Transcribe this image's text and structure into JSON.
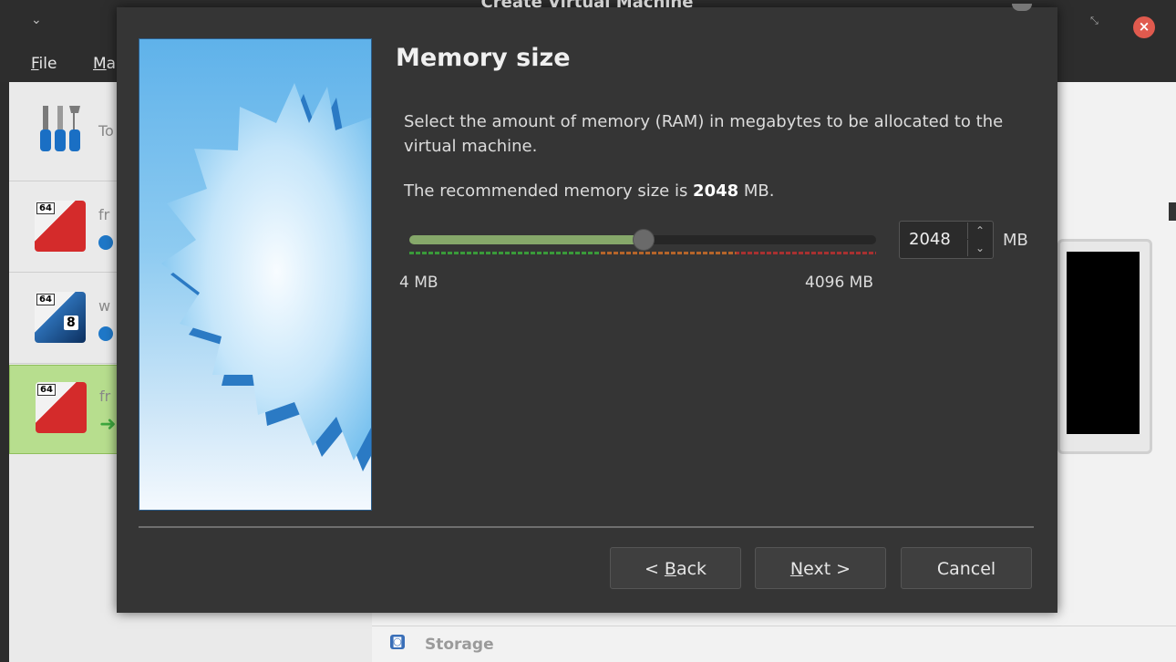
{
  "main_window": {
    "menu": [
      {
        "label_first": "F",
        "label_rest": "ile"
      },
      {
        "label_first": "M",
        "label_rest": "a"
      }
    ],
    "vms": [
      {
        "name": "To",
        "kind": "tools"
      },
      {
        "name": "fr",
        "badge": "64"
      },
      {
        "name": "w",
        "badge": "64",
        "version": "8"
      },
      {
        "name": "fr",
        "badge": "64"
      }
    ],
    "details": {
      "storage_label": "Storage"
    }
  },
  "dialog": {
    "title": "Create Virtual Machine",
    "page_title": "Memory size",
    "description": "Select the amount of memory (RAM) in megabytes to be allocated to the virtual machine.",
    "recommend_prefix": "The recommended memory size is ",
    "recommend_value": "2048",
    "recommend_suffix": " MB.",
    "slider": {
      "min_label": "4 MB",
      "max_label": "4096 MB",
      "min": 4,
      "max": 4096,
      "value": 2048
    },
    "memory_value": "2048",
    "memory_unit": "MB",
    "buttons": {
      "back_prefix": "< ",
      "back_mnemonic": "B",
      "back_rest": "ack",
      "next_mnemonic": "N",
      "next_rest": "ext >",
      "cancel": "Cancel"
    }
  },
  "colors": {
    "slider_fill": "#86a86a",
    "close_button": "#e05a4e",
    "selected_row": "#b7de8e"
  }
}
